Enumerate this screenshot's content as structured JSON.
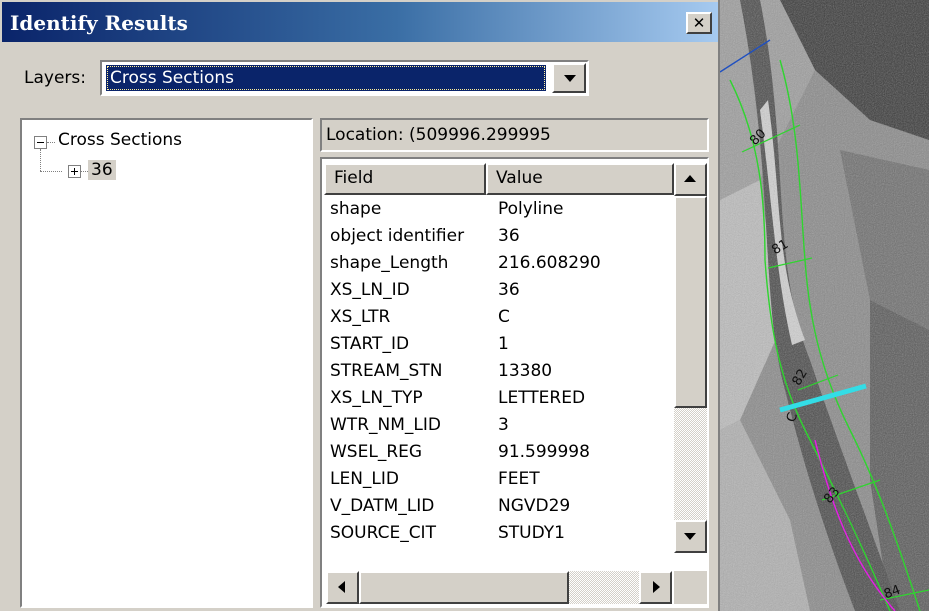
{
  "window": {
    "title": "Identify Results",
    "close_glyph": "✕"
  },
  "layers": {
    "label": "Layers:",
    "selected": "Cross Sections"
  },
  "tree": {
    "root_label": "Cross Sections",
    "child_label": "36"
  },
  "location": {
    "text": "Location: (509996.299995"
  },
  "table": {
    "columns": [
      "Field",
      "Value"
    ],
    "rows": [
      {
        "field": "shape",
        "value": "Polyline"
      },
      {
        "field": "object identifier",
        "value": "36"
      },
      {
        "field": "shape_Length",
        "value": "216.608290"
      },
      {
        "field": "XS_LN_ID",
        "value": "36"
      },
      {
        "field": "XS_LTR",
        "value": "C"
      },
      {
        "field": "START_ID",
        "value": "1"
      },
      {
        "field": "STREAM_STN",
        "value": "13380"
      },
      {
        "field": "XS_LN_TYP",
        "value": "LETTERED"
      },
      {
        "field": "WTR_NM_LID",
        "value": "3"
      },
      {
        "field": "WSEL_REG",
        "value": "91.599998"
      },
      {
        "field": "LEN_LID",
        "value": "FEET"
      },
      {
        "field": "V_DATM_LID",
        "value": "NGVD29"
      },
      {
        "field": "SOURCE_CIT",
        "value": "STUDY1"
      }
    ]
  },
  "map": {
    "labels": [
      "80",
      "81",
      "82",
      "83",
      "84",
      "C"
    ],
    "colors": {
      "stream_line": "#2fd52f",
      "selected_section": "#33dde6",
      "magenta_line": "#e81ce8",
      "blue_line": "#2050c0"
    }
  },
  "icons": {
    "expand": "plus-box-icon",
    "collapse": "minus-box-icon"
  }
}
